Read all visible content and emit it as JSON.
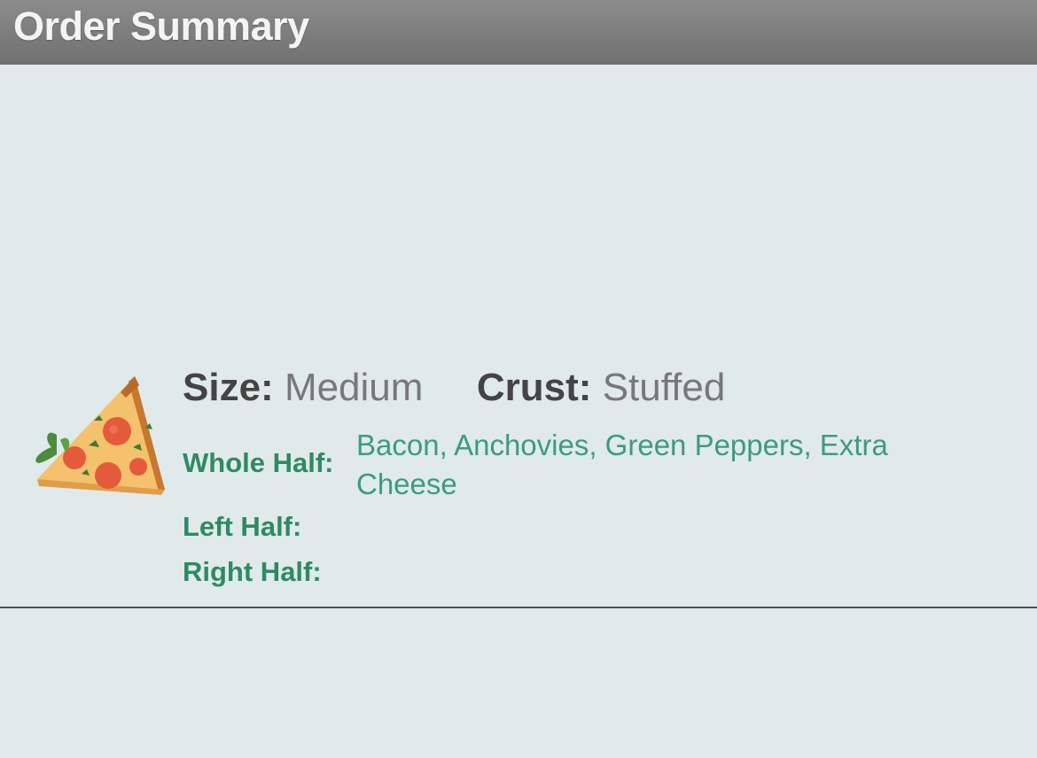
{
  "header": {
    "title": "Order Summary"
  },
  "order": {
    "size_label": "Size:",
    "size_value": "Medium",
    "crust_label": "Crust:",
    "crust_value": "Stuffed",
    "whole_half_label": "Whole Half:",
    "whole_half_value": "Bacon, Anchovies, Green Peppers, Extra Cheese",
    "left_half_label": "Left Half:",
    "left_half_value": "",
    "right_half_label": "Right Half:",
    "right_half_value": "",
    "icon": "pizza-slice-icon"
  },
  "colors": {
    "titlebar": "#7d7d7d",
    "background": "#e0eaea",
    "topping_label": "#2e8a63",
    "topping_value": "#3d9c7a"
  }
}
